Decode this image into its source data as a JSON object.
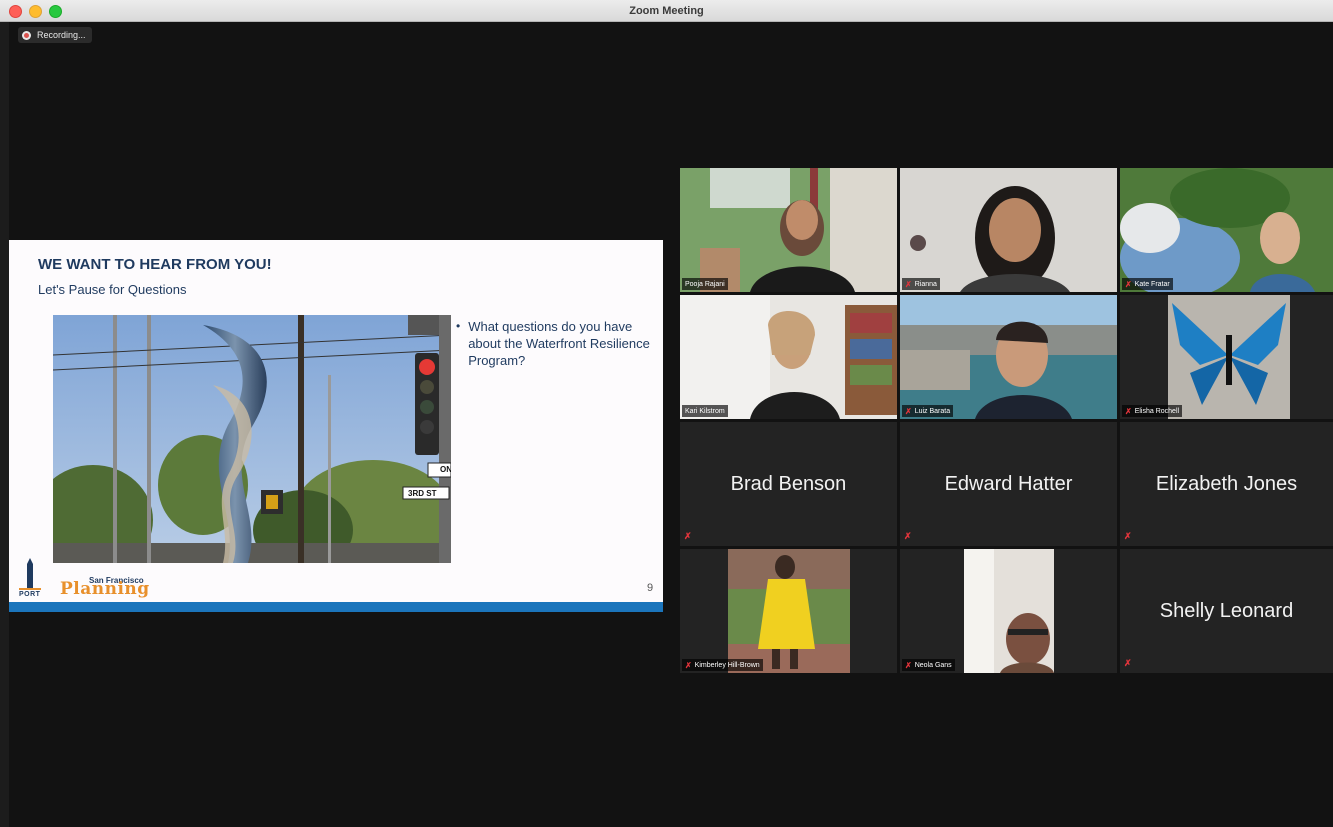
{
  "window": {
    "title": "Zoom Meeting"
  },
  "recording": {
    "label": "Recording..."
  },
  "slide": {
    "heading": "WE WANT TO HEAR FROM YOU!",
    "subheading": "Let's Pause for Questions",
    "bullet": "What questions do you have about the Waterfront Resilience Program?",
    "page_number": "9",
    "logo_port": "PORT",
    "logo_sf": "San Francisco",
    "logo_planning": "Planning",
    "photo_signs": [
      "3RD ST",
      "ON"
    ]
  },
  "participants": [
    {
      "name": "Pooja Rajani",
      "video": true,
      "muted": false,
      "active_speaker": true
    },
    {
      "name": "Rianna",
      "video": true,
      "muted": true
    },
    {
      "name": "Kate Fratar",
      "video": true,
      "muted": true
    },
    {
      "name": "Kari Kilstrom",
      "video": true,
      "muted": false
    },
    {
      "name": "Luiz Barata",
      "video": true,
      "muted": true
    },
    {
      "name": "Elisha Rochell",
      "video": true,
      "muted": true
    },
    {
      "name": "Brad Benson",
      "video": false,
      "muted": true
    },
    {
      "name": "Edward Hatter",
      "video": false,
      "muted": true
    },
    {
      "name": "Elizabeth Jones",
      "video": false,
      "muted": true
    },
    {
      "name": "Kimberley Hill-Brown",
      "video": true,
      "muted": true
    },
    {
      "name": "Neola Gans",
      "video": true,
      "muted": true
    },
    {
      "name": "Shelly Leonard",
      "video": false,
      "muted": true
    }
  ],
  "colors": {
    "accent_active": "#c6e06a",
    "slide_title": "#1f3a5f",
    "muted_icon": "#e0343b",
    "slide_bar": "#1b75bc"
  }
}
